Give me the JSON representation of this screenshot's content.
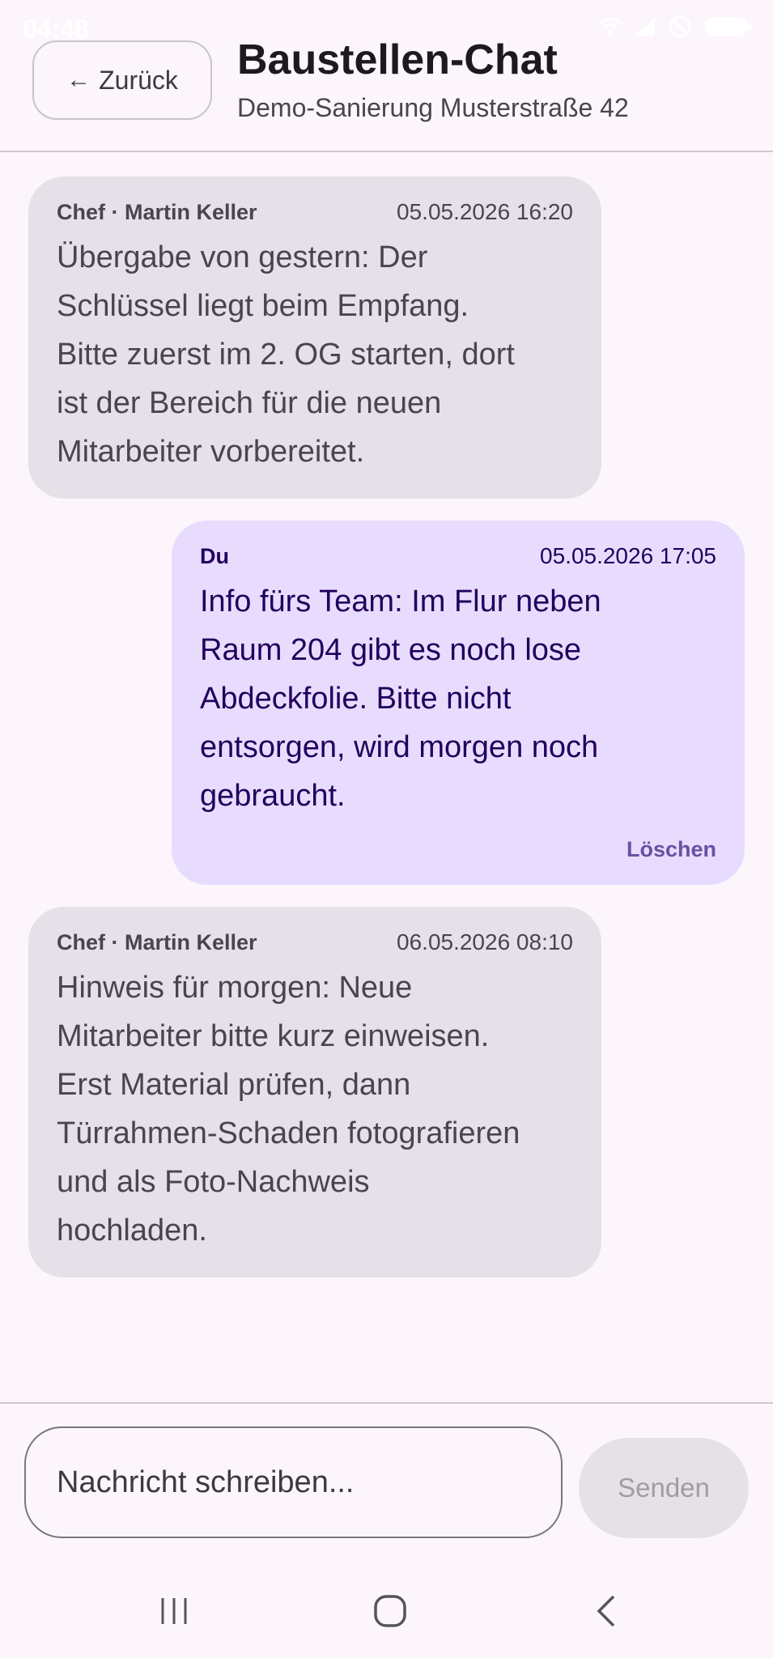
{
  "status_bar": {
    "time": "04:48",
    "icons": [
      "wifi-icon",
      "signal-icon",
      "dnd-icon",
      "battery-icon"
    ]
  },
  "header": {
    "back_label": "Zurück",
    "title": "Baustellen-Chat",
    "subtitle": "Demo-Sanierung Musterstraße 42"
  },
  "messages": [
    {
      "sender": "Chef · Martin Keller",
      "timestamp": "05.05.2026 16:20",
      "lines": [
        "Übergabe von gestern: Der",
        "Schlüssel liegt beim Empfang.",
        "Bitte zuerst im 2. OG starten, dort",
        "ist der Bereich für die neuen",
        "Mitarbeiter vorbereitet."
      ],
      "outgoing": false
    },
    {
      "sender": "Du",
      "timestamp": "05.05.2026 17:05",
      "lines": [
        "Info fürs Team: Im Flur neben",
        "Raum 204 gibt es noch lose",
        "Abdeckfolie. Bitte nicht",
        "entsorgen, wird morgen noch",
        "gebraucht."
      ],
      "delete_label": "Löschen",
      "outgoing": true
    },
    {
      "sender": "Chef · Martin Keller",
      "timestamp": "06.05.2026 08:10",
      "lines": [
        "Hinweis für morgen: Neue",
        "Mitarbeiter bitte kurz einweisen.",
        "Erst Material prüfen, dann",
        "Türrahmen-Schaden fotografieren",
        "und als Foto-Nachweis",
        "hochladen."
      ],
      "outgoing": false
    }
  ],
  "composer": {
    "placeholder": "Nachricht schreiben...",
    "send_label": "Senden"
  },
  "colors": {
    "background": "#fcf6fc",
    "incoming_bubble": "#e6e0e9",
    "outgoing_bubble": "#e8dcfe",
    "accent": "#6750a4"
  }
}
